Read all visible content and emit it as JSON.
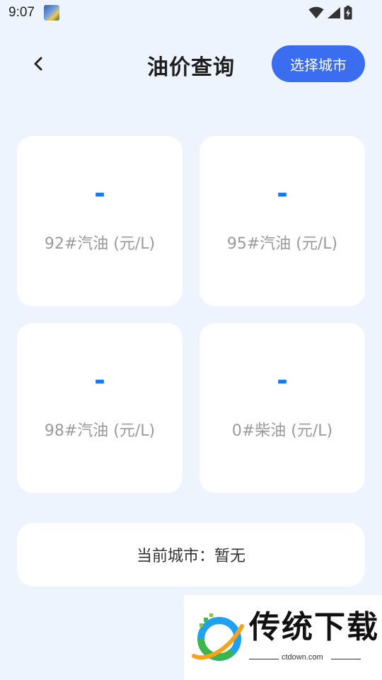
{
  "status_bar": {
    "time": "9:07",
    "icons": [
      "app-notification-icon",
      "wifi-icon",
      "signal-icon",
      "battery-charging-icon"
    ]
  },
  "header": {
    "back_icon": "chevron-left-icon",
    "title": "油价查询",
    "select_city_label": "选择城市"
  },
  "prices": [
    {
      "value": "-",
      "label": "92#汽油 (元/L)"
    },
    {
      "value": "-",
      "label": "95#汽油 (元/L)"
    },
    {
      "value": "-",
      "label": "98#汽油 (元/L)"
    },
    {
      "value": "-",
      "label": "0#柴油 (元/L)"
    }
  ],
  "current_city": {
    "text": "当前城市：暂无"
  },
  "watermark": {
    "title": "传统下载",
    "url": "ctdown.com"
  },
  "colors": {
    "background": "#eef4fd",
    "accent": "#3a6df0",
    "value": "#1677ff",
    "label": "#9a9a9a"
  }
}
